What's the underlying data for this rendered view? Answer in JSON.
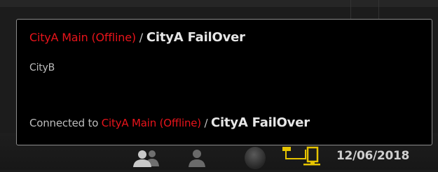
{
  "tooltip": {
    "line1": {
      "offline_server": "CityA Main (Offline)",
      "separator": " / ",
      "active_server": "CityA FailOver"
    },
    "line2": {
      "server": "CityB"
    },
    "line3": {
      "prefix": "Connected to ",
      "offline_server": "CityA Main (Offline)",
      "separator": " / ",
      "active_server": "CityA FailOver"
    }
  },
  "status_bar": {
    "date": "12/06/2018",
    "icons": [
      "users-icon",
      "user-icon",
      "globe-icon",
      "network-icon"
    ]
  },
  "colors": {
    "offline": "#e8141b",
    "network_accent": "#e6c400",
    "tooltip_background": "#000000",
    "tooltip_border": "#8c8c8c"
  }
}
